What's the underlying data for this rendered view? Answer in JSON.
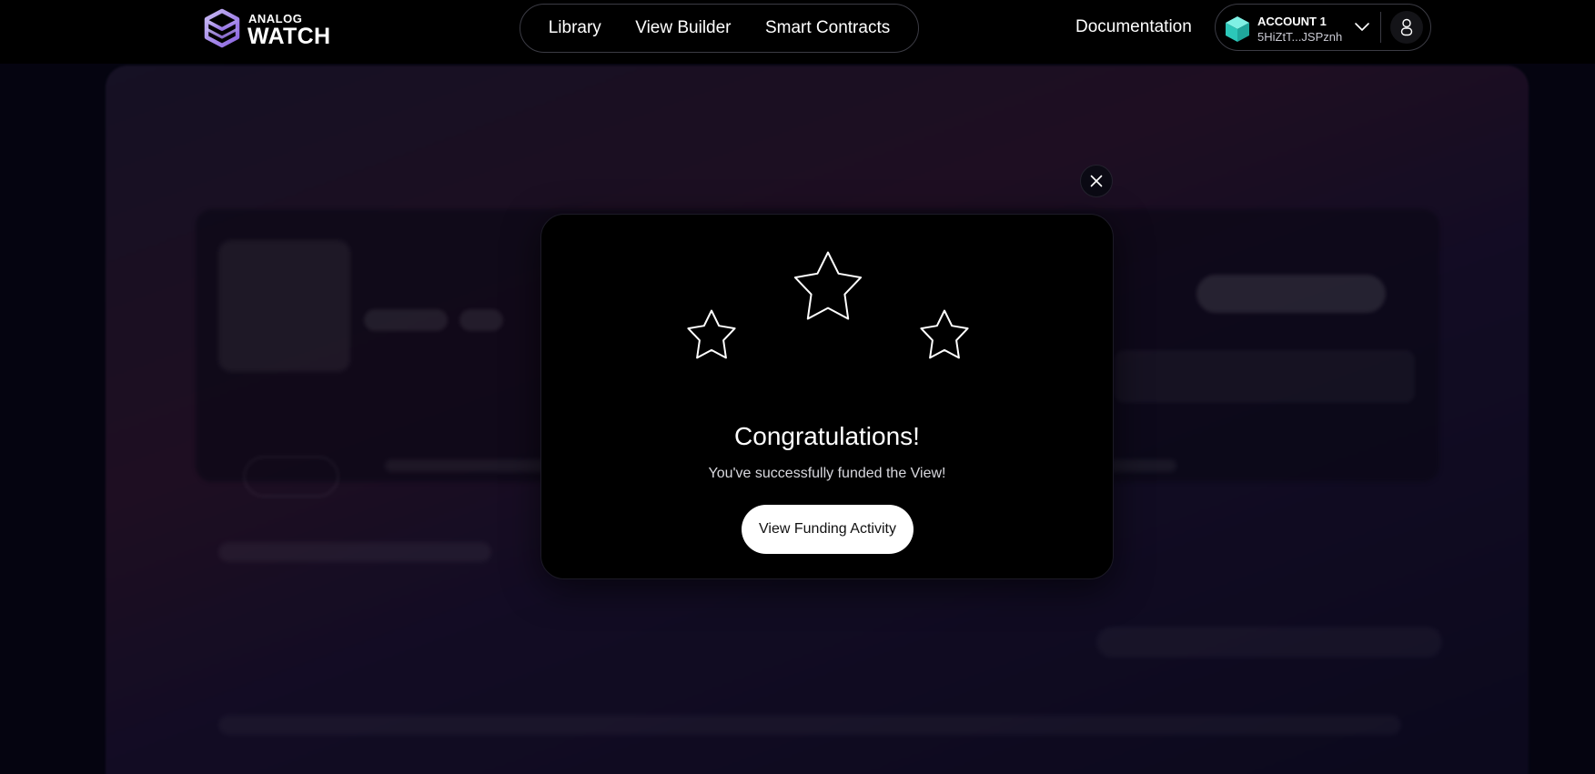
{
  "brand": {
    "name_top": "ANALOG",
    "name_bottom": "WATCH"
  },
  "nav": {
    "items": [
      {
        "label": "Library"
      },
      {
        "label": "View Builder"
      },
      {
        "label": "Smart Contracts"
      }
    ]
  },
  "header": {
    "documentation_label": "Documentation"
  },
  "account": {
    "name": "ACCOUNT 1",
    "address": "5HiZtT...JSPznh"
  },
  "modal": {
    "title": "Congratulations!",
    "message": "You've successfully funded the View!",
    "button_label": "View Funding Activity"
  },
  "colors": {
    "accent_logo": "#9b7ce8",
    "account_cube": "#35d6c9",
    "modal_bg": "#000000",
    "button_bg": "#ffffff"
  },
  "icons": {
    "close": "close-icon",
    "chevron": "chevron-down-icon",
    "user": "user-icon",
    "stars": "star-icon"
  }
}
